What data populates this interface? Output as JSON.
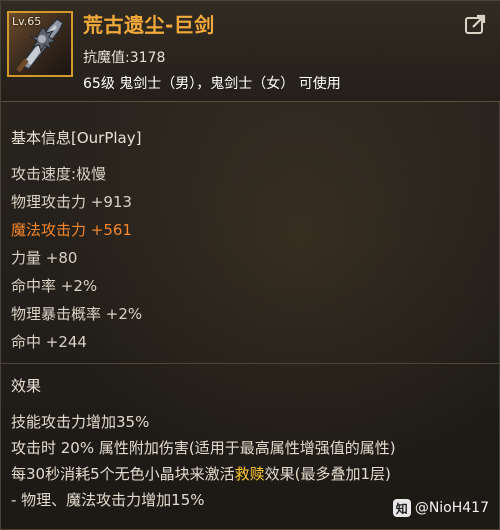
{
  "item": {
    "name": "荒古遗尘-巨剑",
    "level_badge": "Lv.65",
    "resistance": "抗魔值:3178",
    "usable_classes": "65级 鬼剑士（男），鬼剑士（女） 可使用",
    "icon": "greatsword-icon"
  },
  "share_icon": "share-icon",
  "basic": {
    "title": "基本信息[OurPlay]",
    "stats": [
      {
        "text": "攻击速度:极慢",
        "highlight": false
      },
      {
        "text": "物理攻击力 +913",
        "highlight": false
      },
      {
        "text": "魔法攻击力 +561",
        "highlight": true
      },
      {
        "text": "力量 +80",
        "highlight": false
      },
      {
        "text": "命中率 +2%",
        "highlight": false
      },
      {
        "text": "物理暴击概率 +2%",
        "highlight": false
      },
      {
        "text": "命中 +244",
        "highlight": false
      }
    ]
  },
  "effect": {
    "title": "效果",
    "line1": "技能攻击力增加35%",
    "line2": "攻击时 20% 属性附加伤害(适用于最高属性增强值的属性)",
    "line3_pre": "每30秒消耗5个无色小晶块来激活",
    "line3_kw": "救赎",
    "line3_post": "效果(最多叠加1层)",
    "line4": "- 物理、魔法攻击力增加15%"
  },
  "watermark": {
    "text": "@NioH417",
    "badge": "知"
  },
  "colors": {
    "item_name": "#f2a93b",
    "highlight_stat": "#f5862b",
    "keyword": "#ffc82e",
    "frame": "#d29a2a"
  }
}
